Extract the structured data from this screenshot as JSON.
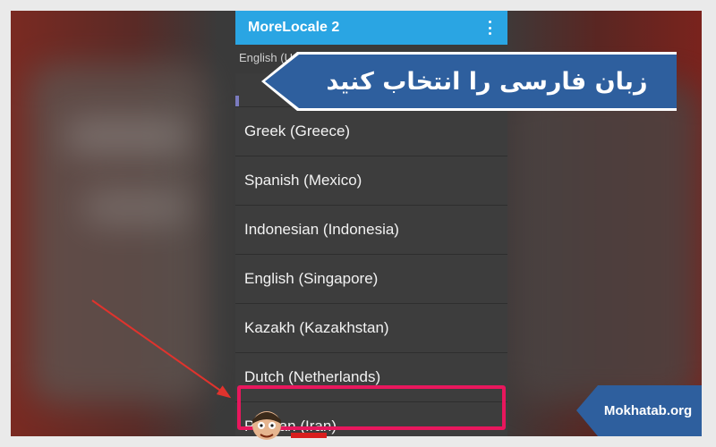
{
  "app": {
    "title": "MoreLocale 2",
    "menu_icon": "more-vertical-icon"
  },
  "current_locale": "English (United States) — en_US",
  "locales": [
    "Greek (Greece)",
    "Spanish (Mexico)",
    "Indonesian (Indonesia)",
    "English (Singapore)",
    "Kazakh (Kazakhstan)",
    "Dutch (Netherlands)",
    "Persian (Iran)"
  ],
  "overlay": {
    "banner_text": "زبان فارسی را انتخاب کنید",
    "brand": "Mokhatab.org",
    "arrow_icon": "arrow-icon",
    "highlight_color": "#e8175d",
    "banner_color": "#2e5f9e"
  },
  "colors": {
    "appbar": "#2aa5e3",
    "list_bg": "#3d3d3d",
    "text": "#f2f2f2"
  }
}
